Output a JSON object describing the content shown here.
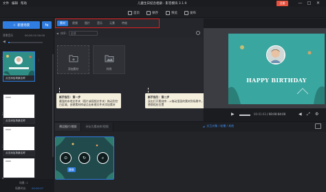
{
  "window": {
    "menus": [
      "文件",
      "编辑",
      "帮助"
    ],
    "title": "儿童生日纪念相册 - 影音模块 3.1.9",
    "register_button": "注册",
    "controls": [
      "—",
      "□",
      "✕"
    ]
  },
  "toolbar": {
    "items": [
      {
        "label": "首页",
        "icon": "home-icon"
      },
      {
        "label": "保存",
        "icon": "save-icon"
      },
      {
        "label": "预览",
        "icon": "preview-icon"
      },
      {
        "label": "发布",
        "icon": "publish-icon"
      }
    ]
  },
  "left_panel": {
    "new_scene_label": "新建场景",
    "side_button": "⇆",
    "position_label": "背景音乐",
    "time_label": "00:00:10  00:00",
    "scenes": [
      {
        "num": "1",
        "caption": "点击添加场景名称",
        "badge": ""
      },
      {
        "num": "2",
        "caption": "点击添加场景名称",
        "badge": "0000"
      },
      {
        "num": "3",
        "caption": "点击添加场景名称",
        "badge": "0000"
      },
      {
        "num": "4",
        "caption": "点击添加场景名称",
        "badge": "0000"
      }
    ],
    "footer_label": "场景: 1",
    "scene_time_label": "场景时长:",
    "scene_time_value": "00:00:07"
  },
  "center_panel": {
    "category_tabs": [
      "素材",
      "视频",
      "图片",
      "音乐",
      "元素",
      "特效"
    ],
    "search_label": "排序:",
    "search_placeholder": "全部",
    "assets": [
      {
        "label": "添加素材"
      },
      {
        "label": "样例"
      }
    ]
  },
  "tips": {
    "step1": {
      "title": "新手指引：第一步",
      "body": "最强的本地文件夹（图片或视频文件夹）拖动到空白区域，创建素材库或点击新建文件夹添加素材"
    },
    "step2": {
      "title": "新手指引：第二步",
      "body": "双击打开素材库- ->拖动里面的素材到场景中，替换相应位置"
    }
  },
  "preview": {
    "headline": "HAPPY BIRTHDAY",
    "time_current": "00:01:03",
    "time_total": "00:00:04:00",
    "controls": [
      "play-icon",
      "volume-icon",
      "fullscreen-icon",
      "settings-icon"
    ]
  },
  "timeline": {
    "tabs": [
      "预设图片/视频",
      "另存为素材库/视频"
    ],
    "right_link": "交互对象 / 轮播 / 其他",
    "clip_replace_label": "替换"
  }
}
